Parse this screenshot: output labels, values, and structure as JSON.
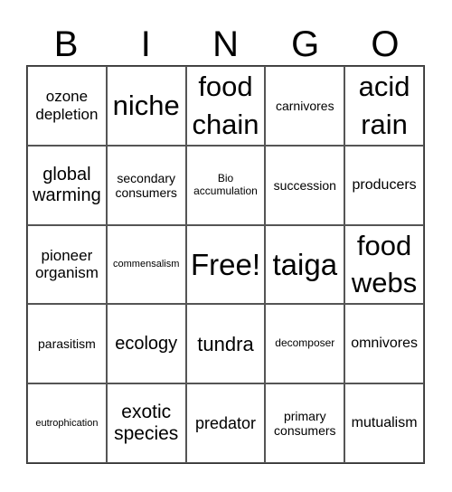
{
  "header": [
    "B",
    "I",
    "N",
    "G",
    "O"
  ],
  "cells": [
    [
      "ozone depletion",
      "niche",
      "food chain",
      "carnivores",
      "acid rain"
    ],
    [
      "global warming",
      "secondary consumers",
      "Bio accumulation",
      "succession",
      "producers"
    ],
    [
      "pioneer organism",
      "commensalism",
      "Free!",
      "taiga",
      "food webs"
    ],
    [
      "parasitism",
      "ecology",
      "tundra",
      "decomposer",
      "omnivores"
    ],
    [
      "eutrophication",
      "exotic species",
      "predator",
      "primary consumers",
      "mutualism"
    ]
  ]
}
